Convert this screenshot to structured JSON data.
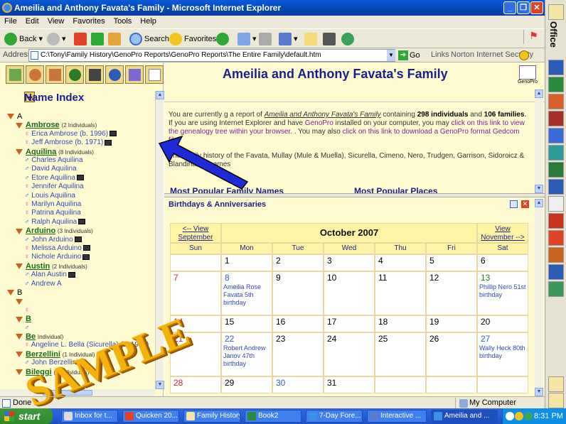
{
  "window": {
    "title": "Ameilia and Anthony Favata's Family - Microsoft Internet Explorer"
  },
  "menu": [
    "File",
    "Edit",
    "View",
    "Favorites",
    "Tools",
    "Help"
  ],
  "toolbar": {
    "back": "Back",
    "search": "Search",
    "favorites": "Favorites"
  },
  "address": {
    "label": "Address",
    "value": "C:\\Tony\\Family History\\GenoPro Reports\\GenoPro Reports\\The Entire Family\\default.htm",
    "go": "Go",
    "links": "Links",
    "norton": "Norton Internet Security"
  },
  "officebar": {
    "label": "Office"
  },
  "page": {
    "title": "Ameilia and Anthony Favata's Family",
    "logo": "GenoPro",
    "intro": {
      "p1a": "You are currently ",
      "p1b": "g a report of ",
      "familylink": "Ameilia and Anthony Favata's Family",
      "p1c": " containing ",
      "individuals": "298 individuals",
      "p1d": " and ",
      "families": "106 families",
      "p1e": ". If you are using Internet Explorer and have ",
      "genopro": "GenoPro",
      "p1f": " installed on your computer, you may ",
      "link1": "click on this link to view the genealogy tree within your browser.",
      "p1g": " . You may also ",
      "link2": "click on this link to download a GenoPro format Gedcom file.",
      "p2": "The family history of the Favata, Mullay (Mule & Muella), Sicurella, Cimeno, Nero, Trudgen, Garrison, Sidoroicz & Blandina Surnames"
    },
    "mostPopularNames": "Most Popular Family Names",
    "mostPopularPlaces": "Most Popular Places"
  },
  "nameIndex": {
    "title": "Name Index",
    "rows": [
      {
        "type": "letter",
        "text": "A"
      },
      {
        "type": "family",
        "text": "Ambrose",
        "count": "(2 Individuals)"
      },
      {
        "type": "person",
        "sex": "f",
        "text": "Erica Ambrose (b. 1996)",
        "photo": true
      },
      {
        "type": "person",
        "sex": "f",
        "text": "Jeff Ambrose (b. 1971)",
        "photo": true
      },
      {
        "type": "family",
        "text": "Aquilina",
        "count": "(8 Individuals)"
      },
      {
        "type": "person",
        "sex": "m",
        "text": "Charles Aquilina",
        "photo": false
      },
      {
        "type": "person",
        "sex": "m",
        "text": "David Aquilina",
        "photo": false
      },
      {
        "type": "person",
        "sex": "m",
        "text": "Etore Aquilina",
        "photo": true
      },
      {
        "type": "person",
        "sex": "f",
        "text": "Jennifer Aquilina",
        "photo": false
      },
      {
        "type": "person",
        "sex": "m",
        "text": "Louis Aquilina",
        "photo": false
      },
      {
        "type": "person",
        "sex": "f",
        "text": "Marilyn Aquilina",
        "photo": false
      },
      {
        "type": "person",
        "sex": "f",
        "text": "Patrina Aquilina",
        "photo": false
      },
      {
        "type": "person",
        "sex": "m",
        "text": "Ralph Aquilina",
        "photo": true
      },
      {
        "type": "family",
        "text": "Arduino",
        "count": "(3 Individuals)"
      },
      {
        "type": "person",
        "sex": "m",
        "text": "John Arduino",
        "photo": true
      },
      {
        "type": "person",
        "sex": "f",
        "text": "Melissa Arduino",
        "photo": true
      },
      {
        "type": "person",
        "sex": "f",
        "text": "Nichole Arduino",
        "photo": true
      },
      {
        "type": "family",
        "text": "Austin",
        "count": "(2 Individuals)"
      },
      {
        "type": "person",
        "sex": "m",
        "text": "Alan Austin",
        "photo": true
      },
      {
        "type": "person",
        "sex": "m",
        "text": "Andrew A",
        "photo": false
      },
      {
        "type": "letter",
        "text": "B"
      },
      {
        "type": "family",
        "text": "",
        "count": ""
      },
      {
        "type": "person",
        "sex": "f",
        "text": "",
        "photo": false
      },
      {
        "type": "family",
        "text": "B",
        "count": ""
      },
      {
        "type": "person",
        "sex": "m",
        "text": "",
        "photo": false
      },
      {
        "type": "family",
        "text": "Be",
        "count": "Individual)"
      },
      {
        "type": "person",
        "sex": "f",
        "text": "Angeline L. Bella (Sicurella) (b. 1913)",
        "photo": false
      },
      {
        "type": "family",
        "text": "Berzellini",
        "count": "(1 Individual)"
      },
      {
        "type": "person",
        "sex": "m",
        "text": "John Berzellini",
        "photo": false
      },
      {
        "type": "family",
        "text": "Bileggi",
        "count": "(2 Individuals)"
      }
    ]
  },
  "watermark": "SAMPLE",
  "birthdays": {
    "title": "Birthdays & Anniversaries",
    "prev": "<-- View September",
    "next": "View November -->",
    "month": "October 2007",
    "weekdays": [
      "Sun",
      "Mon",
      "Tue",
      "Wed",
      "Thu",
      "Fri",
      "Sat"
    ],
    "weeks": [
      [
        {
          "d": ""
        },
        {
          "d": "1"
        },
        {
          "d": "2"
        },
        {
          "d": "3"
        },
        {
          "d": "4"
        },
        {
          "d": "5"
        },
        {
          "d": "6"
        }
      ],
      [
        {
          "d": "7",
          "c": "red"
        },
        {
          "d": "8",
          "c": "blu",
          "note": "Ameilia Rose Favata 5th birthday"
        },
        {
          "d": "9"
        },
        {
          "d": "10"
        },
        {
          "d": "11"
        },
        {
          "d": "12"
        },
        {
          "d": "13",
          "c": "grn",
          "note": "Phillip Nero 51st birthday"
        }
      ],
      [
        {
          "d": "14",
          "c": "red"
        },
        {
          "d": "15"
        },
        {
          "d": "16"
        },
        {
          "d": "17"
        },
        {
          "d": "18"
        },
        {
          "d": "19"
        },
        {
          "d": "20"
        }
      ],
      [
        {
          "d": "21",
          "c": "red"
        },
        {
          "d": "22",
          "c": "blu",
          "note": "Robert Andrew Janov 47th birthday"
        },
        {
          "d": "23"
        },
        {
          "d": "24"
        },
        {
          "d": "25"
        },
        {
          "d": "26"
        },
        {
          "d": "27",
          "c": "blu",
          "note": "Wally Heck 80th birthday"
        }
      ],
      [
        {
          "d": "28",
          "c": "red"
        },
        {
          "d": "29"
        },
        {
          "d": "30",
          "c": "blu"
        },
        {
          "d": "31"
        },
        {
          "d": ""
        },
        {
          "d": ""
        },
        {
          "d": ""
        }
      ]
    ]
  },
  "status": {
    "left": "Done",
    "right": "My Computer"
  },
  "taskbar": {
    "start": "start",
    "tasks": [
      "Inbox for t...",
      "Quicken 20...",
      "Family History",
      "Book2",
      "7-Day Fore...",
      "Interactive ...",
      "Ameilia and ..."
    ],
    "clock": "8:31 PM"
  }
}
